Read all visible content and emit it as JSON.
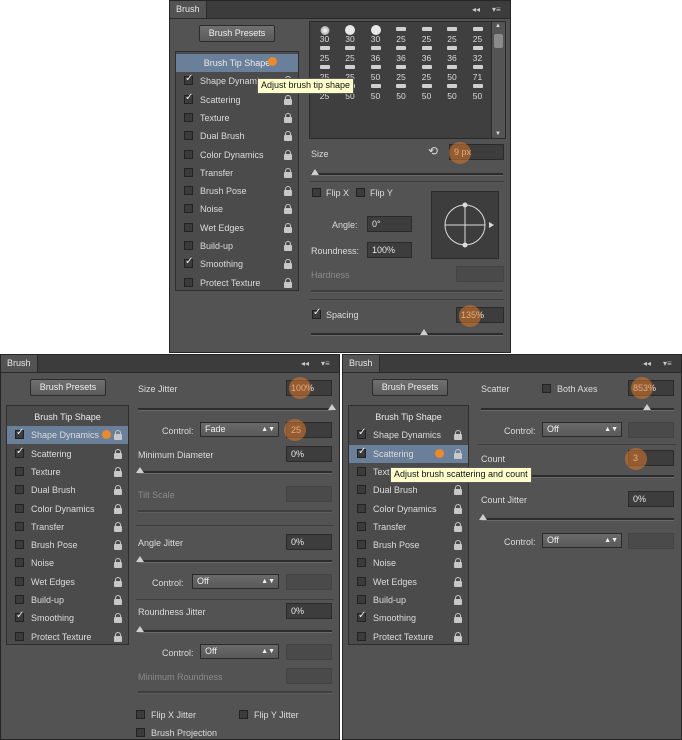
{
  "brush_sizes": [
    "30",
    "30",
    "30",
    "25",
    "25",
    "25",
    "25",
    "25",
    "25",
    "36",
    "36",
    "36",
    "36",
    "32",
    "25",
    "25",
    "50",
    "25",
    "25",
    "50",
    "71",
    "25",
    "50",
    "50",
    "50",
    "50",
    "50",
    "50"
  ],
  "tip_shapes": [
    "soft",
    "hard",
    "hard",
    "brush",
    "brush",
    "brush",
    "brush",
    "brush",
    "brush",
    "brush",
    "brush",
    "brush",
    "brush",
    "brush",
    "brush",
    "brush",
    "brush",
    "brush",
    "brush",
    "brush",
    "brush",
    "brush",
    "brush",
    "brush",
    "brush",
    "brush",
    "brush",
    "brush"
  ],
  "top_panel": {
    "tab": "Brush",
    "menu_controls": "◂◂",
    "presets_button": "Brush Presets",
    "items": [
      {
        "label": "Brush Tip Shape",
        "type": "head",
        "selected": true
      },
      {
        "label": "Shape Dynamics",
        "checked": true
      },
      {
        "label": "Scattering",
        "checked": true
      },
      {
        "label": "Texture",
        "checked": false
      },
      {
        "label": "Dual Brush",
        "checked": false
      },
      {
        "label": "Color Dynamics",
        "checked": false
      },
      {
        "label": "Transfer",
        "checked": false
      },
      {
        "label": "Brush Pose",
        "checked": false
      },
      {
        "label": "Noise",
        "checked": false
      },
      {
        "label": "Wet Edges",
        "checked": false
      },
      {
        "label": "Build-up",
        "checked": false
      },
      {
        "label": "Smoothing",
        "checked": true
      },
      {
        "label": "Protect Texture",
        "checked": false
      }
    ],
    "tooltip": "Adjust brush tip shape",
    "size_label": "Size",
    "size_value": "9 px",
    "size_level": 0.02,
    "flip_x": "Flip X",
    "flip_y": "Flip Y",
    "angle_label": "Angle:",
    "angle_value": "0°",
    "roundness_label": "Roundness:",
    "roundness_value": "100%",
    "hardness_label": "Hardness",
    "spacing_label": "Spacing",
    "spacing_value": "135%",
    "spacing_level": 0.59
  },
  "left_panel": {
    "tab": "Brush",
    "menu_controls": "◂◂",
    "presets_button": "Brush Presets",
    "items": [
      {
        "label": "Brush Tip Shape",
        "type": "head"
      },
      {
        "label": "Shape Dynamics",
        "checked": true,
        "selected": true
      },
      {
        "label": "Scattering",
        "checked": true
      },
      {
        "label": "Texture",
        "checked": false
      },
      {
        "label": "Dual Brush",
        "checked": false
      },
      {
        "label": "Color Dynamics",
        "checked": false
      },
      {
        "label": "Transfer",
        "checked": false
      },
      {
        "label": "Brush Pose",
        "checked": false
      },
      {
        "label": "Noise",
        "checked": false
      },
      {
        "label": "Wet Edges",
        "checked": false
      },
      {
        "label": "Build-up",
        "checked": false
      },
      {
        "label": "Smoothing",
        "checked": true
      },
      {
        "label": "Protect Texture",
        "checked": false
      }
    ],
    "size_jitter_label": "Size Jitter",
    "size_jitter_value": "100%",
    "control_label": "Control:",
    "control_fade": "Fade",
    "fade_value": "25",
    "min_diameter_label": "Minimum Diameter",
    "min_diameter_value": "0%",
    "tilt_scale_label": "Tilt Scale",
    "angle_jitter_label": "Angle Jitter",
    "angle_jitter_value": "0%",
    "control_off": "Off",
    "roundness_jitter_label": "Roundness Jitter",
    "roundness_jitter_value": "0%",
    "min_roundness_label": "Minimum Roundness",
    "flip_x_jitter": "Flip X Jitter",
    "flip_y_jitter": "Flip Y Jitter",
    "brush_projection": "Brush Projection"
  },
  "right_panel": {
    "tab": "Brush",
    "menu_controls": "◂◂",
    "presets_button": "Brush Presets",
    "items": [
      {
        "label": "Brush Tip Shape",
        "type": "head"
      },
      {
        "label": "Shape Dynamics",
        "checked": true
      },
      {
        "label": "Scattering",
        "checked": true,
        "selected": true
      },
      {
        "label": "Texture",
        "checked": false
      },
      {
        "label": "Dual Brush",
        "checked": false
      },
      {
        "label": "Color Dynamics",
        "checked": false
      },
      {
        "label": "Transfer",
        "checked": false
      },
      {
        "label": "Brush Pose",
        "checked": false
      },
      {
        "label": "Noise",
        "checked": false
      },
      {
        "label": "Wet Edges",
        "checked": false
      },
      {
        "label": "Build-up",
        "checked": false
      },
      {
        "label": "Smoothing",
        "checked": true
      },
      {
        "label": "Protect Texture",
        "checked": false
      }
    ],
    "tooltip": "Adjust brush scattering and count",
    "scatter_label": "Scatter",
    "both_axes": "Both Axes",
    "scatter_value": "853%",
    "control_label": "Control:",
    "control_off": "Off",
    "count_label": "Count",
    "count_value": "3",
    "count_jitter_label": "Count Jitter",
    "count_jitter_value": "0%"
  }
}
